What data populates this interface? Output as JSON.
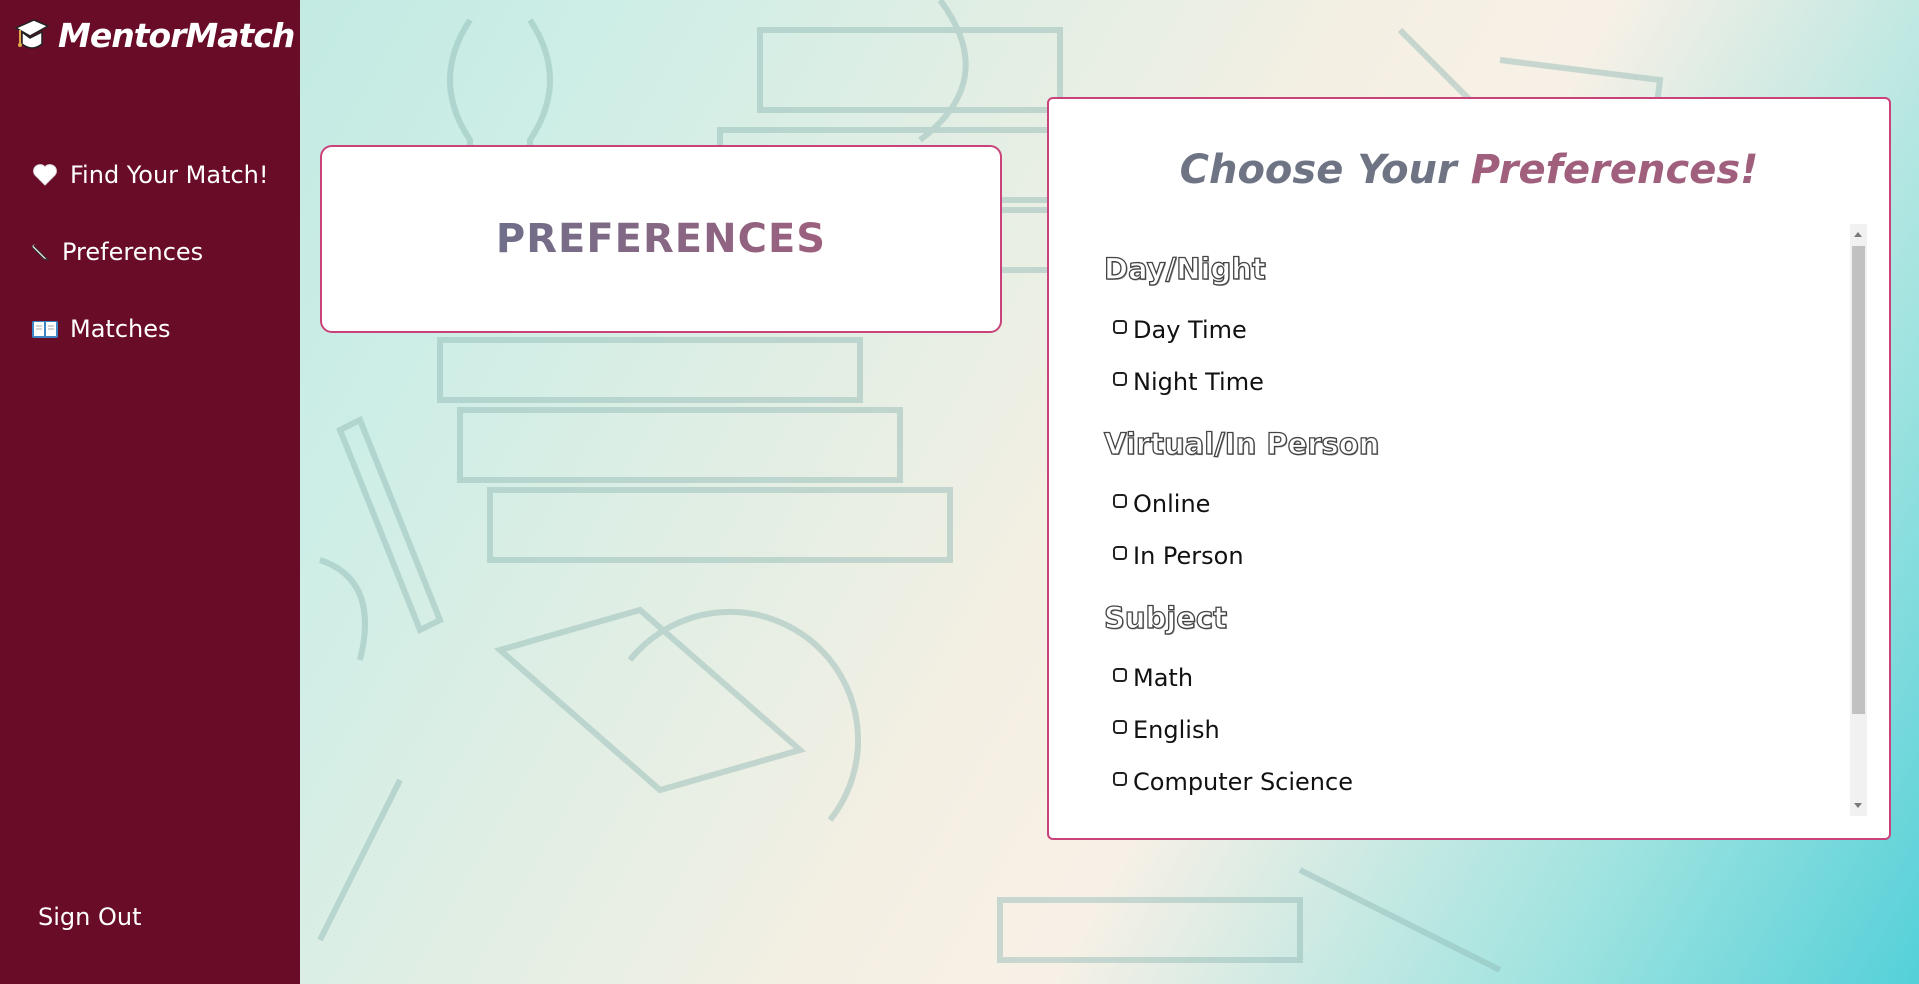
{
  "sidebar": {
    "brand": "MentorMatch",
    "items": [
      {
        "label": "Find Your Match!",
        "icon": "heart-icon"
      },
      {
        "label": "Preferences",
        "icon": "pencil-icon"
      },
      {
        "label": "Matches",
        "icon": "book-icon"
      }
    ],
    "signout": "Sign Out"
  },
  "header": {
    "title": "PREFERENCES"
  },
  "preferences": {
    "heading_part1": "Choose Your ",
    "heading_part2": "Preferences!",
    "groups": [
      {
        "title": "Day/Night",
        "options": [
          "Day Time",
          "Night Time"
        ]
      },
      {
        "title": "Virtual/In Person",
        "options": [
          "Online",
          "In Person"
        ]
      },
      {
        "title": "Subject",
        "options": [
          "Math",
          "English",
          "Computer Science"
        ]
      }
    ]
  },
  "colors": {
    "sidebar": "#690c28",
    "accent_border": "#c9427a",
    "heading_gray": "#6e7484",
    "heading_pink": "#a05f7c"
  }
}
